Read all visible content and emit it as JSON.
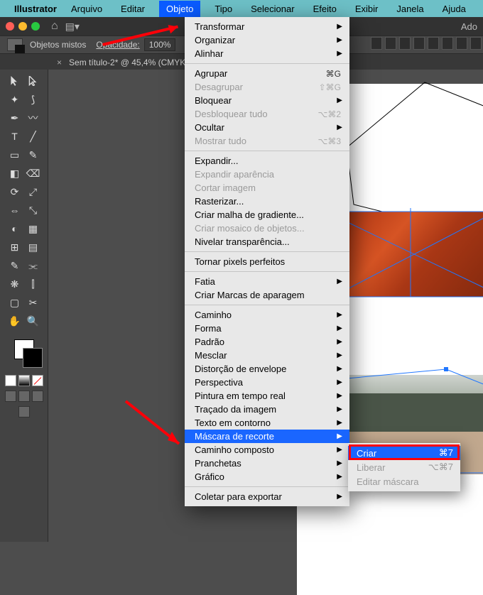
{
  "menubar": {
    "app": "Illustrator",
    "items": [
      "Arquivo",
      "Editar",
      "Objeto",
      "Tipo",
      "Selecionar",
      "Efeito",
      "Exibir",
      "Janela",
      "Ajuda"
    ],
    "active_index": 2
  },
  "header": {
    "right_text": "Ado"
  },
  "options_bar": {
    "label": "Objetos mistos",
    "opacity_label": "Opacidade:",
    "opacity_value": "100%"
  },
  "doc_tab": {
    "title": "Sem título-2* @ 45,4% (CMYK/"
  },
  "dropdown": {
    "groups": [
      [
        {
          "label": "Transformar",
          "sub": true
        },
        {
          "label": "Organizar",
          "sub": true
        },
        {
          "label": "Alinhar",
          "sub": true
        }
      ],
      [
        {
          "label": "Agrupar",
          "sc": "⌘G"
        },
        {
          "label": "Desagrupar",
          "sc": "⇧⌘G",
          "disabled": true
        },
        {
          "label": "Bloquear",
          "sub": true
        },
        {
          "label": "Desbloquear tudo",
          "sc": "⌥⌘2",
          "disabled": true
        },
        {
          "label": "Ocultar",
          "sub": true
        },
        {
          "label": "Mostrar tudo",
          "sc": "⌥⌘3",
          "disabled": true
        }
      ],
      [
        {
          "label": "Expandir..."
        },
        {
          "label": "Expandir aparência",
          "disabled": true
        },
        {
          "label": "Cortar imagem",
          "disabled": true
        },
        {
          "label": "Rasterizar..."
        },
        {
          "label": "Criar malha de gradiente..."
        },
        {
          "label": "Criar mosaico de objetos...",
          "disabled": true
        },
        {
          "label": "Nivelar transparência..."
        }
      ],
      [
        {
          "label": "Tornar pixels perfeitos"
        }
      ],
      [
        {
          "label": "Fatia",
          "sub": true
        },
        {
          "label": "Criar Marcas de aparagem"
        }
      ],
      [
        {
          "label": "Caminho",
          "sub": true
        },
        {
          "label": "Forma",
          "sub": true
        },
        {
          "label": "Padrão",
          "sub": true
        },
        {
          "label": "Mesclar",
          "sub": true
        },
        {
          "label": "Distorção de envelope",
          "sub": true
        },
        {
          "label": "Perspectiva",
          "sub": true
        },
        {
          "label": "Pintura em tempo real",
          "sub": true
        },
        {
          "label": "Traçado da imagem",
          "sub": true
        },
        {
          "label": "Texto em contorno",
          "sub": true
        },
        {
          "label": "Máscara de recorte",
          "sub": true,
          "highlight": true
        },
        {
          "label": "Caminho composto",
          "sub": true
        },
        {
          "label": "Pranchetas",
          "sub": true
        },
        {
          "label": "Gráfico",
          "sub": true
        }
      ],
      [
        {
          "label": "Coletar para exportar",
          "sub": true
        }
      ]
    ]
  },
  "submenu": {
    "items": [
      {
        "label": "Criar",
        "sc": "⌘7",
        "highlight": true
      },
      {
        "label": "Liberar",
        "sc": "⌥⌘7",
        "disabled": true
      },
      {
        "label": "Editar máscara",
        "disabled": true
      }
    ]
  }
}
